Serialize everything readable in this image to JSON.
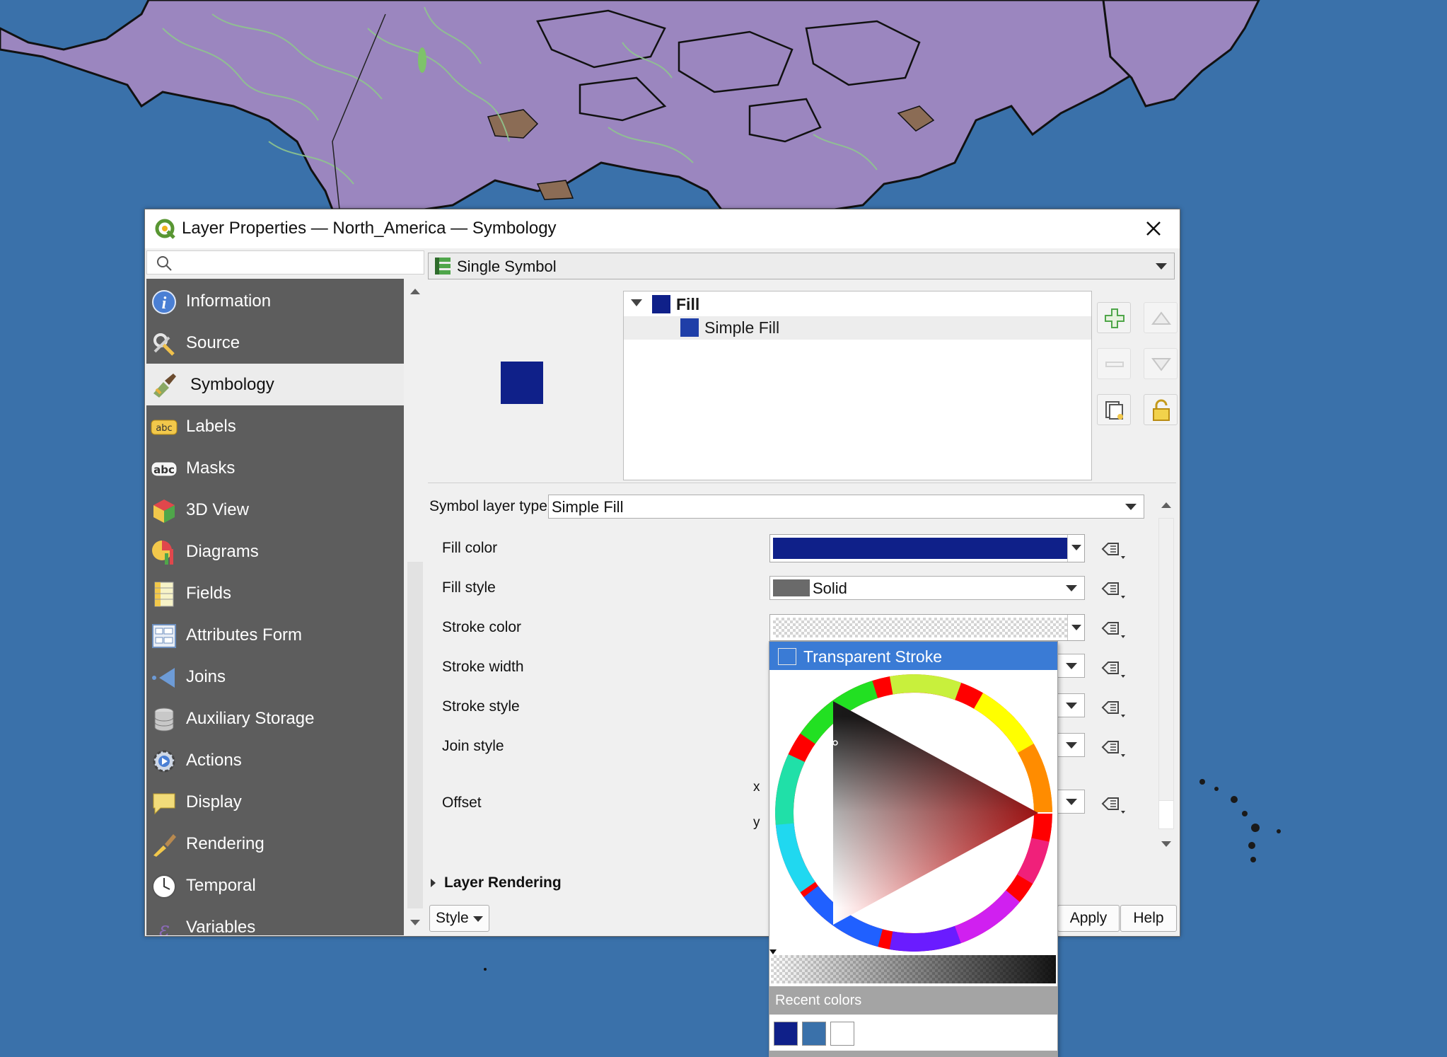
{
  "window": {
    "title": "Layer Properties — North_America — Symbology"
  },
  "search": {
    "placeholder": "",
    "value": ""
  },
  "sidebar": {
    "items": [
      {
        "label": "Information",
        "icon": "information-icon",
        "active": false
      },
      {
        "label": "Source",
        "icon": "source-icon",
        "active": false
      },
      {
        "label": "Symbology",
        "icon": "symbology-icon",
        "active": true
      },
      {
        "label": "Labels",
        "icon": "labels-icon",
        "active": false
      },
      {
        "label": "Masks",
        "icon": "masks-icon",
        "active": false
      },
      {
        "label": "3D View",
        "icon": "3d-view-icon",
        "active": false
      },
      {
        "label": "Diagrams",
        "icon": "diagrams-icon",
        "active": false
      },
      {
        "label": "Fields",
        "icon": "fields-icon",
        "active": false
      },
      {
        "label": "Attributes Form",
        "icon": "attributes-form-icon",
        "active": false
      },
      {
        "label": "Joins",
        "icon": "joins-icon",
        "active": false
      },
      {
        "label": "Auxiliary Storage",
        "icon": "auxiliary-storage-icon",
        "active": false
      },
      {
        "label": "Actions",
        "icon": "actions-icon",
        "active": false
      },
      {
        "label": "Display",
        "icon": "display-icon",
        "active": false
      },
      {
        "label": "Rendering",
        "icon": "rendering-icon",
        "active": false
      },
      {
        "label": "Temporal",
        "icon": "temporal-icon",
        "active": false
      },
      {
        "label": "Variables",
        "icon": "variables-icon",
        "active": false
      }
    ]
  },
  "renderer": {
    "selected": "Single Symbol"
  },
  "symbol_tree": {
    "root": {
      "label": "Fill",
      "color": "#0f2089"
    },
    "child": {
      "label": "Simple Fill",
      "color": "#1f3fa8"
    }
  },
  "symbol_layer": {
    "type_label": "Symbol layer type",
    "type_value": "Simple Fill",
    "fields": {
      "fill_color": {
        "label": "Fill color",
        "color": "#0f2089"
      },
      "fill_style": {
        "label": "Fill style",
        "value": "Solid"
      },
      "stroke_color": {
        "label": "Stroke color",
        "value": "transparent"
      },
      "stroke_width": {
        "label": "Stroke width"
      },
      "stroke_style": {
        "label": "Stroke style"
      },
      "join_style": {
        "label": "Join style"
      },
      "offset": {
        "label": "Offset",
        "x_label": "x",
        "y_label": "y"
      }
    }
  },
  "layer_rendering": {
    "label": "Layer Rendering"
  },
  "buttons": {
    "style": "Style",
    "apply": "Apply",
    "help": "Help"
  },
  "color_popup": {
    "transparent_label": "Transparent Stroke",
    "recent_label": "Recent colors",
    "recent_colors": [
      "#0f2089",
      "#3a71aa",
      "#ffffff"
    ],
    "hue": 0
  },
  "colors": {
    "map_ocean": "#3a71aa",
    "map_land": "#9b86bf",
    "map_rivers": "#8fc58e",
    "accent": "#3a7bd5",
    "fill": "#0f2089"
  }
}
